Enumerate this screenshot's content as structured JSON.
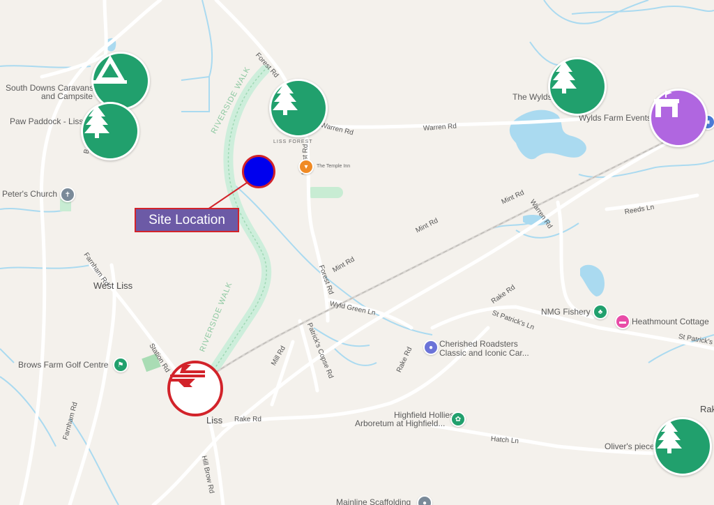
{
  "map": {
    "places": {
      "south_downs_1": "South Downs Caravans",
      "south_downs_2": "and Campsite",
      "paw_paddock": "Paw Paddock - Liss",
      "peters_church": "Peter's Church",
      "west_liss": "West Liss",
      "brows_farm": "Brows Farm Golf Centre",
      "liss_forest": "LISS FOREST",
      "temple_inn": "The Temple Inn",
      "the_wylds": "The Wylds",
      "wylds_farm": "Wylds Farm Events",
      "nmg_fishery": "NMG Fishery",
      "heathmount": "Heathmount Cottage",
      "cherished_1": "Cherished Roadsters",
      "cherished_2": "Classic and Iconic Car...",
      "highfield_1": "Highfield Hollies",
      "highfield_2": "Arboretum at Highfield...",
      "olivers_piece": "Oliver's piece",
      "liss": "Liss",
      "mainline": "Mainline Scaffolding",
      "rak": "Rak"
    },
    "roads": {
      "forest_rd_top": "Forest Rd",
      "forest_rd_mid": "Forest Rd",
      "forest_rd_lower": "Forest Rd",
      "warren_rd_1": "Warren Rd",
      "warren_rd_2": "Warren Rd",
      "warren_rd_3": "Warren Rd",
      "mint_rd_1": "Mint Rd",
      "mint_rd_2": "Mint Rd",
      "mint_rd_3": "Mint Rd",
      "reeds_ln": "Reeds Ln",
      "farnham_rd_1": "Farnham Rd",
      "farnham_rd_2": "Farnham Rd",
      "station_rd": "Station Rd",
      "mill_rd": "Mill Rd",
      "wyld_green_ln": "Wyld Green Ln",
      "patricks_copse": "Patrick's Copse Rd",
      "rake_rd_1": "Rake Rd",
      "rake_rd_2": "Rake Rd",
      "rake_rd_3": "Rake Rd",
      "st_patricks_1": "St Patrick's Ln",
      "st_patricks_2": "St Patrick's L",
      "hatch_ln": "Hatch Ln",
      "hill_brow_rd": "Hill Brow Rd",
      "b_road": "B"
    },
    "walks": {
      "riverside_1": "RIVERSIDE WALK",
      "riverside_2": "RIVERSIDE WALK"
    },
    "site_label": "Site Location"
  },
  "icons": {
    "campsite": "campsite-icon",
    "tree": "tree-icon",
    "castle": "castle-icon",
    "railway": "railway-icon"
  },
  "colors": {
    "green_marker": "#21a06d",
    "purple_marker": "#b066e0",
    "rail_red": "#d2232a",
    "site_blue": "#0000ee",
    "site_label_bg": "#6c5aa6",
    "water": "#aadaf0"
  }
}
